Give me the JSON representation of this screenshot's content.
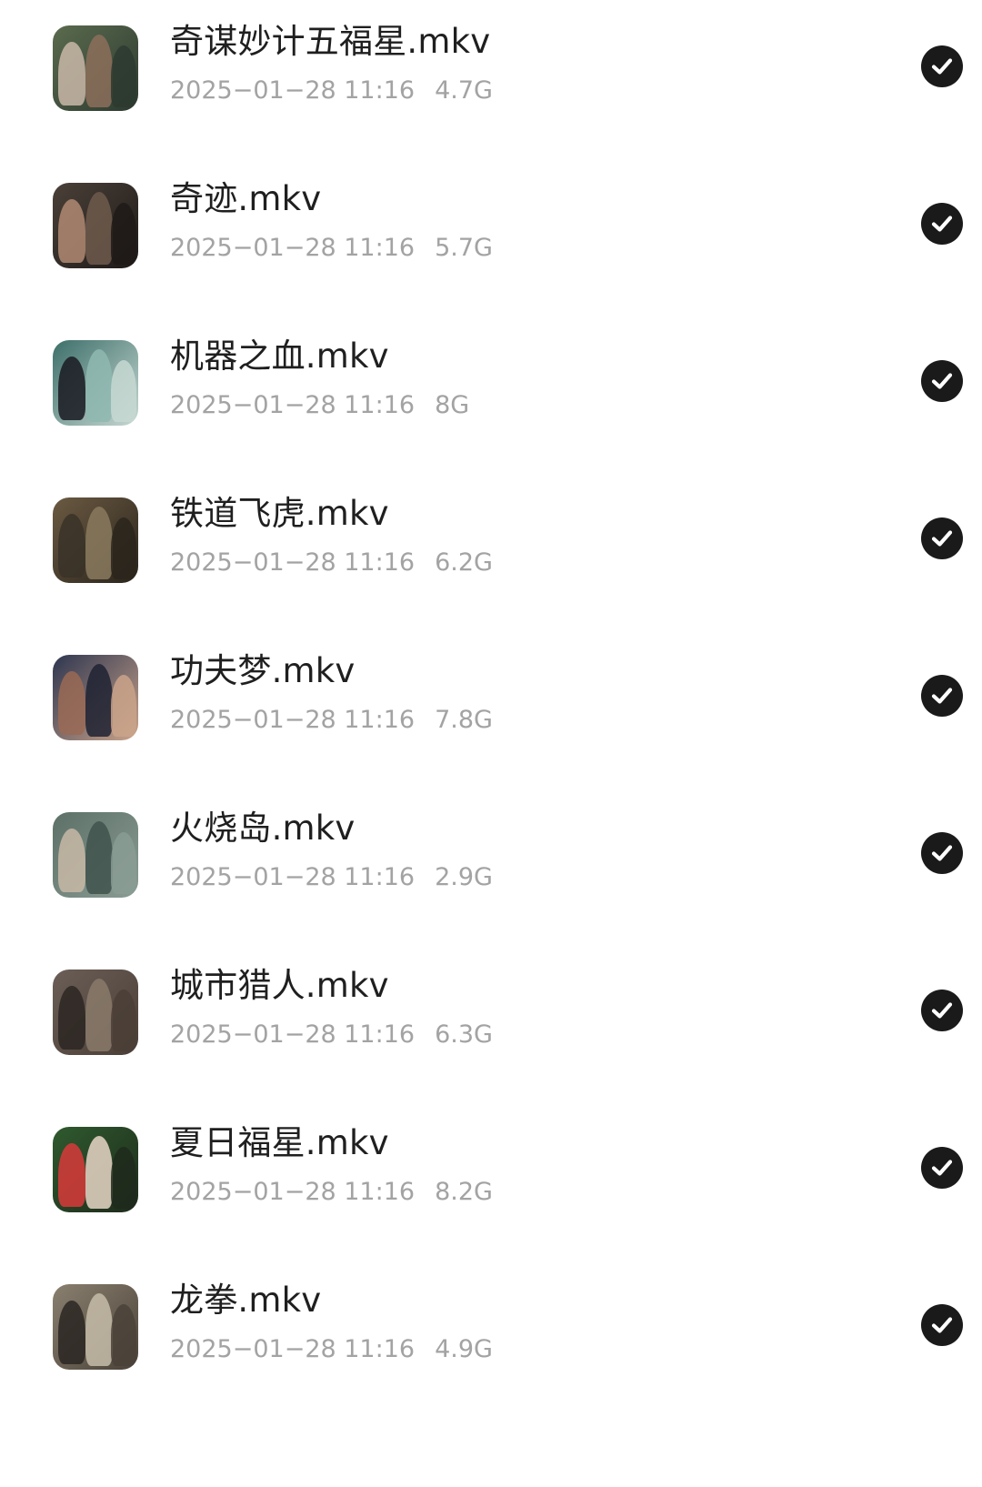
{
  "files": [
    {
      "name": "奇谋妙计五福星.mkv",
      "date": "2025−01−28 11:16",
      "size": "4.7G",
      "thumb_colors": [
        "#5a6b4e",
        "#c9b7a8",
        "#8c6f5a",
        "#2d3a30"
      ]
    },
    {
      "name": "奇迹.mkv",
      "date": "2025−01−28 11:16",
      "size": "5.7G",
      "thumb_colors": [
        "#4a4038",
        "#b08a72",
        "#6e5a4c",
        "#1e1a18"
      ]
    },
    {
      "name": "机器之血.mkv",
      "date": "2025−01−28 11:16",
      "size": "8G",
      "thumb_colors": [
        "#3d6f6a",
        "#1a1a22",
        "#8fb8b0",
        "#c7d8d2"
      ]
    },
    {
      "name": "铁道飞虎.mkv",
      "date": "2025−01−28 11:16",
      "size": "6.2G",
      "thumb_colors": [
        "#6b5a42",
        "#3a3328",
        "#8a7a5e",
        "#2a241c"
      ]
    },
    {
      "name": "功夫梦.mkv",
      "date": "2025−01−28 11:16",
      "size": "7.8G",
      "thumb_colors": [
        "#2e3650",
        "#9a6a55",
        "#1f2233",
        "#caa38a"
      ]
    },
    {
      "name": "火烧岛.mkv",
      "date": "2025−01−28 11:16",
      "size": "2.9G",
      "thumb_colors": [
        "#5d7068",
        "#c8b8a6",
        "#40524c",
        "#8a9c94"
      ]
    },
    {
      "name": "城市猎人.mkv",
      "date": "2025−01−28 11:16",
      "size": "6.3G",
      "thumb_colors": [
        "#6a5e56",
        "#2c2622",
        "#8a7a6a",
        "#4a3e36"
      ]
    },
    {
      "name": "夏日福星.mkv",
      "date": "2025−01−28 11:16",
      "size": "8.2G",
      "thumb_colors": [
        "#2f5a2e",
        "#d83a3a",
        "#e8d6c6",
        "#1e2a1c"
      ]
    },
    {
      "name": "龙拳.mkv",
      "date": "2025−01−28 11:16",
      "size": "4.9G",
      "thumb_colors": [
        "#8a8070",
        "#2a2622",
        "#c6bca8",
        "#4a4238"
      ]
    }
  ],
  "icons": {
    "selected": "check-circle-icon"
  },
  "colors": {
    "title_text": "#1f1f1f",
    "meta_text": "#a3a3a3",
    "check_fill": "#1a1a1a"
  }
}
